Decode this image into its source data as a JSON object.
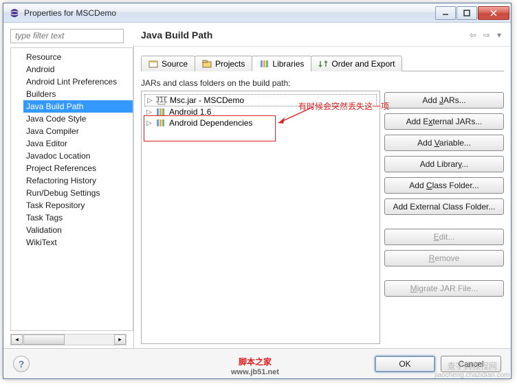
{
  "window": {
    "title": "Properties for MSCDemo"
  },
  "filter": {
    "placeholder": "type filter text"
  },
  "heading": "Java Build Path",
  "sidebar": {
    "items": [
      {
        "label": "Resource"
      },
      {
        "label": "Android"
      },
      {
        "label": "Android Lint Preferences"
      },
      {
        "label": "Builders"
      },
      {
        "label": "Java Build Path",
        "selected": true
      },
      {
        "label": "Java Code Style"
      },
      {
        "label": "Java Compiler"
      },
      {
        "label": "Java Editor"
      },
      {
        "label": "Javadoc Location"
      },
      {
        "label": "Project References"
      },
      {
        "label": "Refactoring History"
      },
      {
        "label": "Run/Debug Settings"
      },
      {
        "label": "Task Repository"
      },
      {
        "label": "Task Tags"
      },
      {
        "label": "Validation"
      },
      {
        "label": "WikiText"
      }
    ]
  },
  "tabs": [
    {
      "label": "Source",
      "icon": "source"
    },
    {
      "label": "Projects",
      "icon": "projects"
    },
    {
      "label": "Libraries",
      "icon": "libraries",
      "active": true
    },
    {
      "label": "Order and Export",
      "icon": "order"
    }
  ],
  "subtitle": "JARs and class folders on the build path:",
  "entries": [
    {
      "label": "Msc.jar - MSCDemo",
      "icon": "jar",
      "ghost": true
    },
    {
      "label": "Android 1.6",
      "icon": "lib"
    },
    {
      "label": "Android Dependencies",
      "icon": "lib"
    }
  ],
  "buttons": {
    "add_jars": "Add JARs...",
    "add_ext_jars": "Add External JARs...",
    "add_variable": "Add Variable...",
    "add_library": "Add Library...",
    "add_class": "Add Class Folder...",
    "add_ext_class": "Add External Class Folder...",
    "edit": "Edit...",
    "remove": "Remove",
    "migrate": "Migrate JAR File...",
    "ok": "OK",
    "cancel": "Cancel"
  },
  "annot": {
    "text": "有时候会突然丢失这一项"
  },
  "wm1": {
    "a": "脚本之家",
    "b": "www.jb51.net"
  },
  "wm2": {
    "a": "查字典教程网",
    "b": "jiaocheng.chazidian.com"
  }
}
